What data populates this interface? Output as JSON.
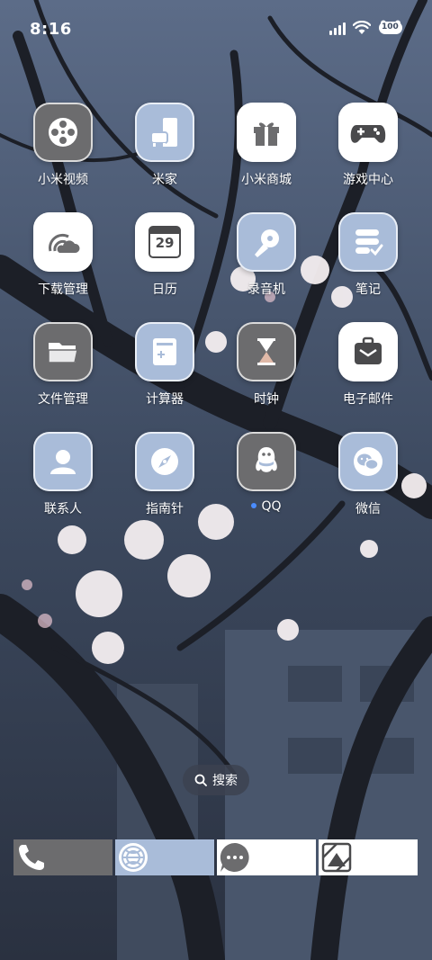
{
  "status": {
    "time": "8:16",
    "battery_label": "100"
  },
  "apps": [
    {
      "label": "小米视频",
      "icon": "film-reel-icon",
      "name": "app-mi-video"
    },
    {
      "label": "米家",
      "icon": "home-devices-icon",
      "name": "app-mijia"
    },
    {
      "label": "小米商城",
      "icon": "gift-icon",
      "name": "app-mi-store"
    },
    {
      "label": "游戏中心",
      "icon": "gamepad-icon",
      "name": "app-game-center"
    },
    {
      "label": "下载管理",
      "icon": "cloud-download-icon",
      "name": "app-downloads"
    },
    {
      "label": "日历",
      "icon": "calendar-icon",
      "name": "app-calendar",
      "date": "29"
    },
    {
      "label": "录音机",
      "icon": "microphone-icon",
      "name": "app-recorder"
    },
    {
      "label": "笔记",
      "icon": "notes-icon",
      "name": "app-notes"
    },
    {
      "label": "文件管理",
      "icon": "folder-icon",
      "name": "app-file-manager"
    },
    {
      "label": "计算器",
      "icon": "calculator-icon",
      "name": "app-calculator"
    },
    {
      "label": "时钟",
      "icon": "hourglass-icon",
      "name": "app-clock"
    },
    {
      "label": "电子邮件",
      "icon": "mail-icon",
      "name": "app-email"
    },
    {
      "label": "联系人",
      "icon": "contact-icon",
      "name": "app-contacts"
    },
    {
      "label": "指南针",
      "icon": "compass-icon",
      "name": "app-compass"
    },
    {
      "label": "QQ",
      "icon": "penguin-icon",
      "name": "app-qq"
    },
    {
      "label": "微信",
      "icon": "wechat-icon",
      "name": "app-wechat"
    }
  ],
  "search": {
    "label": "搜索"
  },
  "dock": [
    {
      "icon": "phone-icon",
      "name": "dock-phone"
    },
    {
      "icon": "browser-icon",
      "name": "dock-browser"
    },
    {
      "icon": "message-icon",
      "name": "dock-messages"
    },
    {
      "icon": "gallery-icon",
      "name": "dock-gallery"
    }
  ],
  "colors": {
    "tile_blue": "#a9bcd9",
    "tile_gray": "#6c6c6e",
    "tile_white": "#ffffff",
    "notify_dot": "#4a8cff"
  }
}
